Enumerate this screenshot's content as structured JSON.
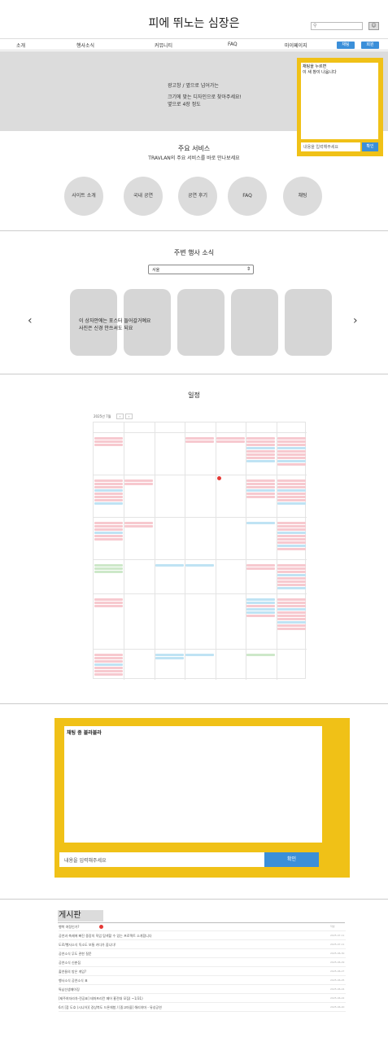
{
  "header": {
    "site_title": "피에 뛰노는 심장은",
    "search_icon": "search-icon",
    "user_icon": "user-icon"
  },
  "nav": {
    "items": [
      "소개",
      "행사소식",
      "커뮤니티",
      "FAQ",
      "마이페이지"
    ],
    "buttons": [
      "채팅",
      "회원"
    ]
  },
  "banner": {
    "lines": [
      "광고창 / 옆으로 넘어가는",
      "크기에 맞는 디자인으로 찾아주세요!",
      "옆으로 4장 정도"
    ]
  },
  "chat_widget": {
    "log_line1": "채팅을 누르면",
    "log_line2": "이 새 창이 나옵니다",
    "placeholder": "내용을 입력해주세요",
    "send": "확인"
  },
  "services": {
    "title": "주요 서비스",
    "subtitle": "TRAVLAN의 주요 서비스를 바로 만나보세요",
    "items": [
      "사이트 소개",
      "국내 공연",
      "공연 후기",
      "FAQ",
      "채팅"
    ]
  },
  "events": {
    "title": "주변 행사 소식",
    "selected_region": "서울",
    "poster_note1": "이 상자안에는 포스터 들어갈거예요",
    "poster_note2": "사진은 신경 안쓰셔도 되요"
  },
  "schedule": {
    "title": "일정",
    "month_label": "2025년 7월",
    "prev": "‹",
    "next": "›"
  },
  "big_chat": {
    "content": "채팅 중 블라블라",
    "placeholder": "내용을 입력해주세요",
    "send": "확인"
  },
  "board": {
    "title": "게시판",
    "posts": [
      {
        "title": "행복 여정인가?",
        "date": "작성"
      },
      {
        "title": "공연과 축제에 빠진 중장의 직업 탐색할 수 있는 프로젝트 소개합니다",
        "date": "2025-07-11"
      },
      {
        "title": "도로/행사소식 독소도 보통 카다가 줍니다!",
        "date": "2025-07-11"
      },
      {
        "title": "공연소식 무도 관한 질문",
        "date": "2025-06-30"
      },
      {
        "title": "공연소식 신춘집",
        "date": "2025-06-29"
      },
      {
        "title": "출연들의 방은 게임?",
        "date": "2025-06-27"
      },
      {
        "title": "행사소식 공연소식 표",
        "date": "2025-06-25"
      },
      {
        "title": "특남선생페이징",
        "date": "2025-06-24"
      },
      {
        "title": "[제주여자라차-전공표] 테마프리칸 페어 홍전대 모집( ~1/31)",
        "date": "2025-06-22"
      },
      {
        "title": "6기 [참 도호 (시니어)] 경상북도 드론체험 / [중고마을] 해리야마 - 뮤성공연",
        "date": "2025-06-20"
      }
    ]
  }
}
